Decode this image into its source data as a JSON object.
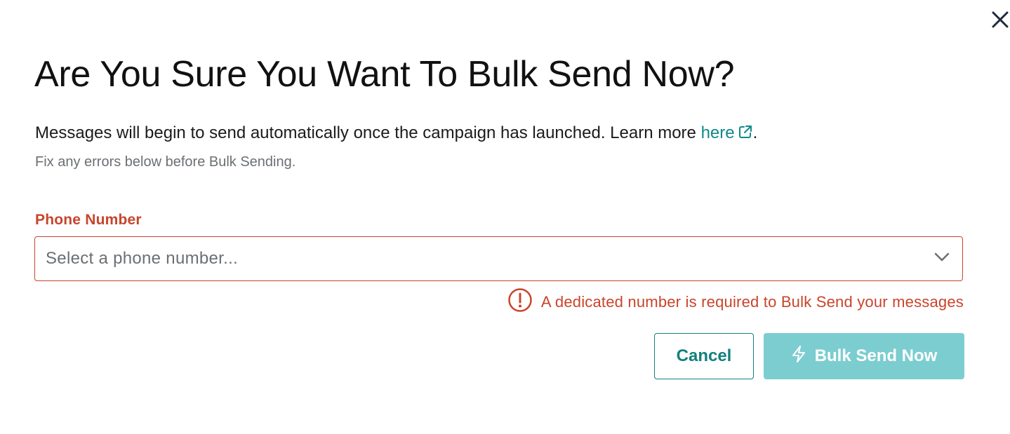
{
  "modal": {
    "title": "Are You Sure You Want To Bulk Send Now?",
    "description": "Messages will begin to send automatically once the campaign has launched. Learn more ",
    "link_text": "here",
    "description_end": ".",
    "subdescription": "Fix any errors below before Bulk Sending.",
    "field": {
      "label": "Phone Number",
      "placeholder": "Select a phone number...",
      "error": "A dedicated number is required to Bulk Send your messages"
    },
    "buttons": {
      "cancel": "Cancel",
      "primary": "Bulk Send Now"
    },
    "icons": {
      "close": "close-icon",
      "external_link": "external-link-icon",
      "chevron": "chevron-down-icon",
      "error": "error-icon",
      "bolt": "lightning-bolt-icon"
    },
    "colors": {
      "accent": "#137f80",
      "link": "#0f8a8a",
      "error": "#c9442b",
      "primary_disabled": "#7ccdd0",
      "muted_text": "#6b6f73"
    }
  }
}
